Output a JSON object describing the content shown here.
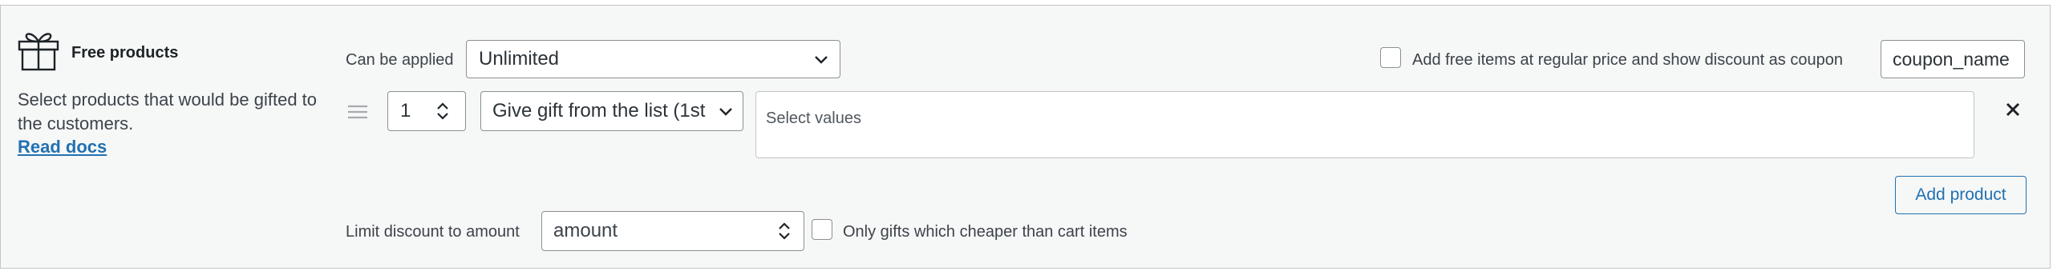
{
  "section": {
    "title": "Free products",
    "description": "Select products that would be gifted to the customers.",
    "read_docs": "Read docs"
  },
  "applied": {
    "label": "Can be applied",
    "value": "Unlimited"
  },
  "regular_price": {
    "label": "Add free items at regular price and show discount as coupon",
    "checked": false,
    "coupon_value": "coupon_name"
  },
  "gift_row": {
    "quantity": "1",
    "mode": "Give gift from the list (1st",
    "values_placeholder": "Select values"
  },
  "add_product_label": "Add product",
  "limit": {
    "label": "Limit discount to amount",
    "placeholder": "amount"
  },
  "cheaper": {
    "label": "Only gifts which cheaper than cart items",
    "checked": false
  },
  "colors": {
    "accent": "#2271b1",
    "panel_bg": "#f6f7f7",
    "border": "#8c8f94"
  },
  "icons": [
    "gift-icon",
    "chevron-down-icon",
    "drag-handle-icon",
    "spinner-icon",
    "close-icon"
  ]
}
